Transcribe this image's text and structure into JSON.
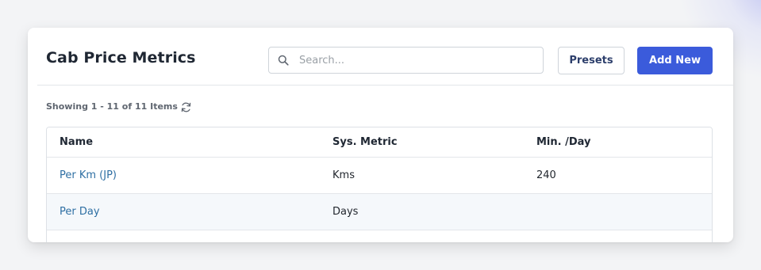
{
  "header": {
    "title": "Cab Price Metrics",
    "search_placeholder": "Search...",
    "search_value": "",
    "presets_label": "Presets",
    "add_new_label": "Add New"
  },
  "summary": {
    "text": "Showing 1 - 11 of 11 Items"
  },
  "table": {
    "columns": [
      "Name",
      "Sys. Metric",
      "Min. /Day"
    ],
    "rows": [
      {
        "name": "Per Km (JP)",
        "metric": "Kms",
        "min_per_day": "240"
      },
      {
        "name": "Per Day",
        "metric": "Days",
        "min_per_day": ""
      }
    ]
  },
  "colors": {
    "accent": "#3b5bdb",
    "link": "#2e6fa3"
  },
  "icons": {
    "search": "search-icon",
    "refresh": "refresh-icon"
  }
}
